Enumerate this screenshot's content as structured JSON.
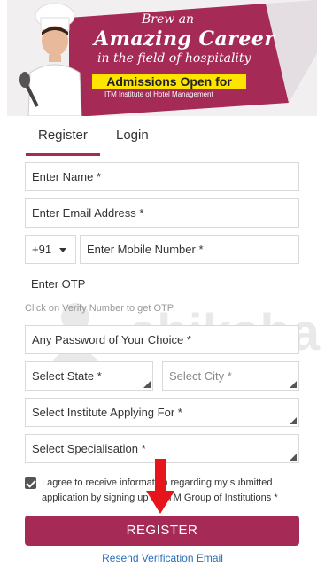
{
  "banner": {
    "line1": "Brew an",
    "line2": "Amazing Career",
    "line3": "in the field of hospitality",
    "admissions": "Admissions Open for",
    "institute": "ITM Institute of Hotel Management"
  },
  "tabs": {
    "register": "Register",
    "login": "Login"
  },
  "form": {
    "name_placeholder": "Enter Name *",
    "email_placeholder": "Enter Email Address *",
    "country_code": "+91",
    "mobile_placeholder": "Enter Mobile Number *",
    "otp_placeholder": "Enter OTP",
    "otp_hint": "Click on Verify Number to get OTP.",
    "password_placeholder": "Any Password of Your Choice *",
    "state_placeholder": "Select State *",
    "city_placeholder": "Select City *",
    "institute_placeholder": "Select Institute Applying For *",
    "specialisation_placeholder": "Select Specialisation *",
    "agree_text": "I agree to receive information regarding my submitted application by signing up on ITM Group of Institutions *",
    "agree_checked": true,
    "register_button": "REGISTER",
    "resend_link": "Resend Verification Email"
  },
  "watermark": "shiksha",
  "colors": {
    "brand": "#a52a56",
    "link": "#2a6fb8",
    "banner_yellow": "#ffe400",
    "arrow": "#e8141b"
  }
}
